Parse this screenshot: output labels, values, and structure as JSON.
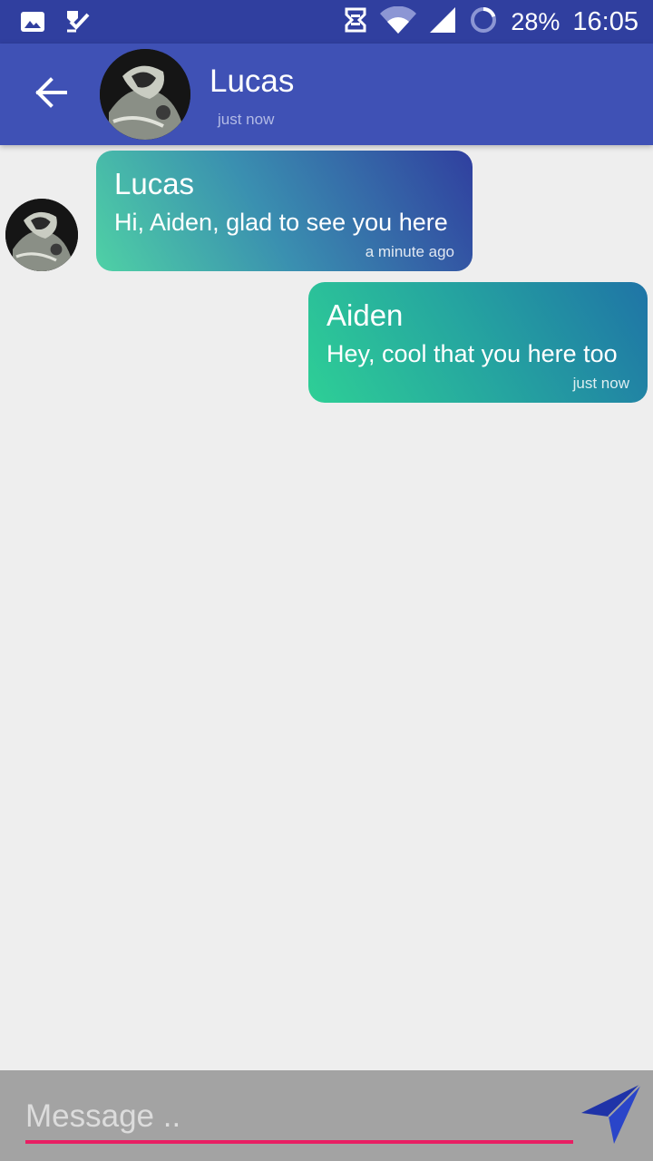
{
  "status_bar": {
    "battery": "28%",
    "time": "16:05",
    "icons": [
      "gallery-icon",
      "task-check-icon",
      "sync-icon",
      "wifi-icon",
      "signal-icon",
      "battery-ring-icon"
    ]
  },
  "header": {
    "name": "Lucas",
    "status": "just now",
    "back_icon": "arrow-back-icon",
    "color": "#3f51b5"
  },
  "messages": [
    {
      "sender": "Lucas",
      "text": "Hi, Aiden, glad to see you here",
      "time": "a minute ago",
      "direction": "incoming"
    },
    {
      "sender": "Aiden",
      "text": "Hey, cool that you here too",
      "time": "just now",
      "direction": "outgoing"
    }
  ],
  "composer": {
    "placeholder": "Message ..",
    "value": "",
    "send_icon": "send-arrow-icon",
    "accent": "#e91e63"
  }
}
